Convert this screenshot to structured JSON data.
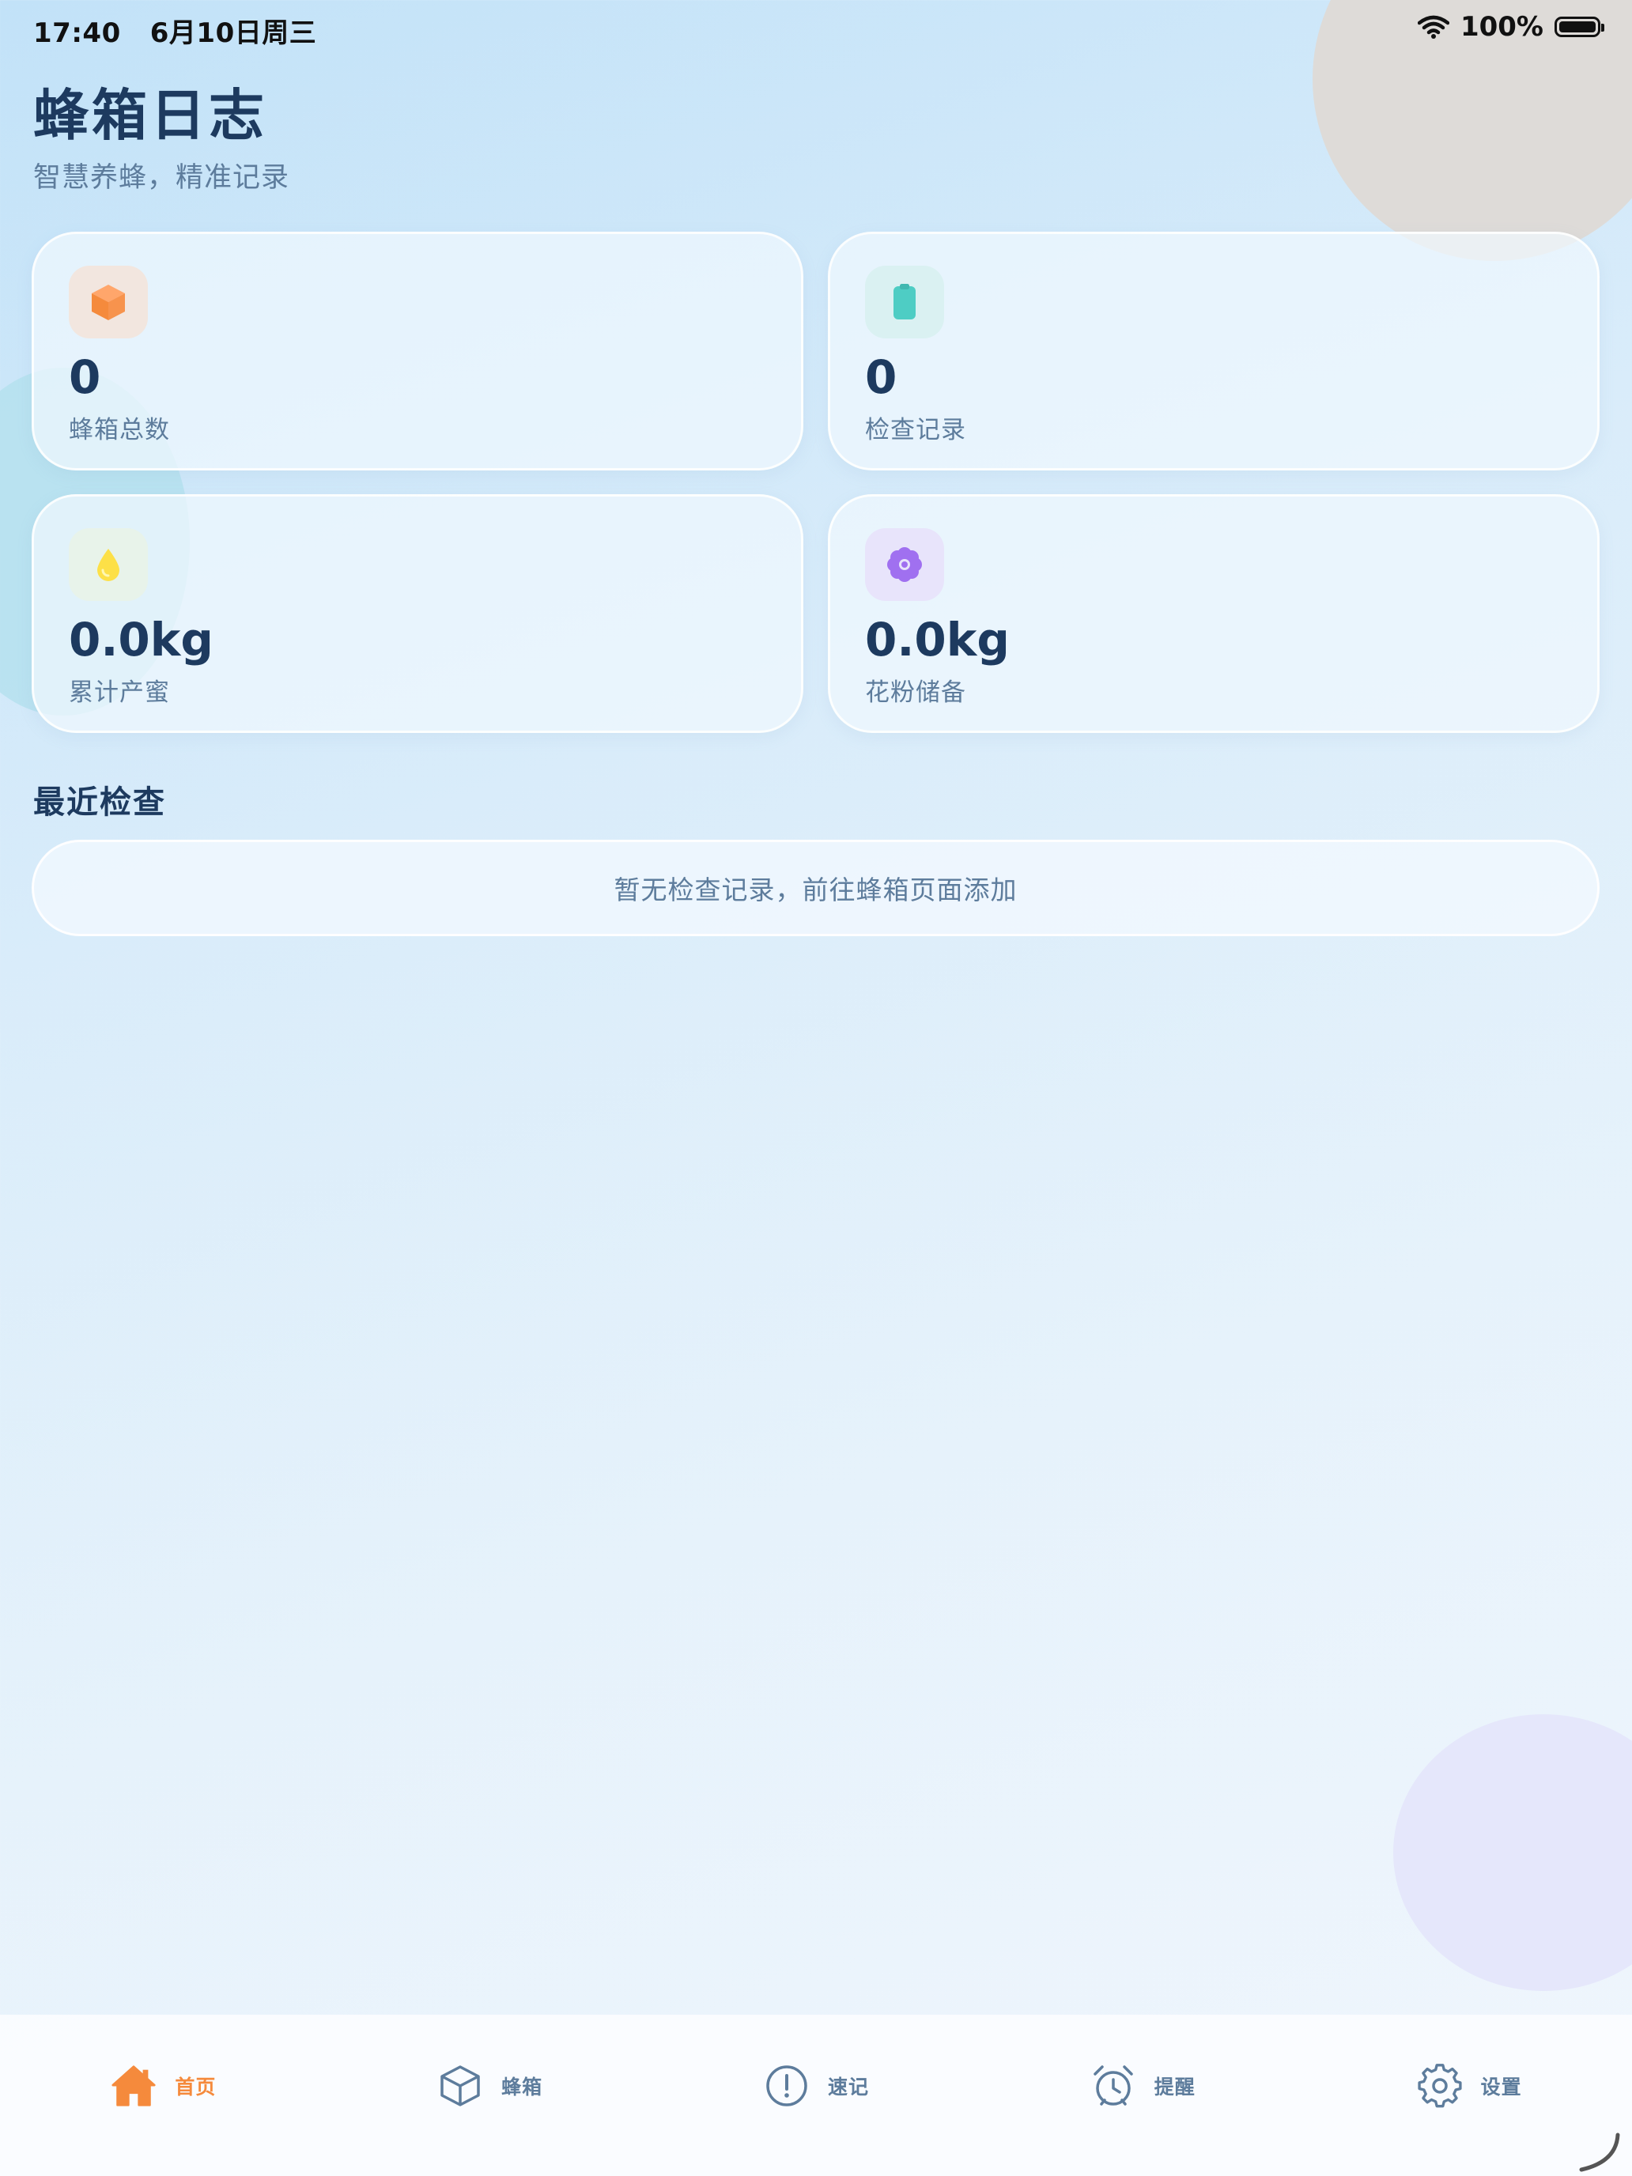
{
  "status_bar": {
    "time": "17:40",
    "date": "6月10日周三",
    "battery": "100%"
  },
  "header": {
    "title": "蜂箱日志",
    "subtitle": "智慧养蜂，精准记录"
  },
  "stats": [
    {
      "value": "0",
      "label": "蜂箱总数",
      "icon": "box-icon",
      "icon_color": "#f58a3c",
      "icon_bg": "#f2e6df"
    },
    {
      "value": "0",
      "label": "检查记录",
      "icon": "clipboard-icon",
      "icon_color": "#4ecdc4",
      "icon_bg": "#daf1f2"
    },
    {
      "value": "0.0kg",
      "label": "累计产蜜",
      "icon": "drop-icon",
      "icon_color": "#fde047",
      "icon_bg": "#e8f3ea"
    },
    {
      "value": "0.0kg",
      "label": "花粉储备",
      "icon": "flower-icon",
      "icon_color": "#a070f0",
      "icon_bg": "#e8e4fb"
    }
  ],
  "recent": {
    "title": "最近检查",
    "empty_text": "暂无检查记录，前往蜂箱页面添加"
  },
  "nav": [
    {
      "label": "首页",
      "icon": "home-icon",
      "active": true
    },
    {
      "label": "蜂箱",
      "icon": "cube-icon",
      "active": false
    },
    {
      "label": "速记",
      "icon": "alert-circle-icon",
      "active": false
    },
    {
      "label": "提醒",
      "icon": "alarm-clock-icon",
      "active": false
    },
    {
      "label": "设置",
      "icon": "gear-icon",
      "active": false
    }
  ],
  "colors": {
    "accent": "#f58a3c",
    "text_primary": "#1d3a5f",
    "text_secondary": "#5d7c9c"
  }
}
